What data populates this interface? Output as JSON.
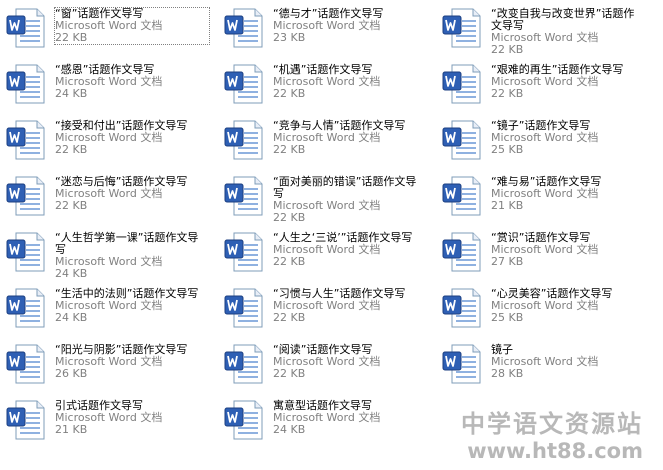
{
  "file_type_label": "Microsoft Word 文档",
  "icon": "word-document-icon",
  "colors": {
    "icon_page": "#ffffff",
    "icon_page_border": "#7f9db9",
    "icon_badge": "#2e5fb4",
    "icon_lines": "#8fb1e0",
    "type_text": "#808080",
    "watermark": "#b8b8b8"
  },
  "files": [
    {
      "name": "“窗”话题作文导写",
      "size": "22 KB",
      "selected": true
    },
    {
      "name": "“德与才”话题作文导写",
      "size": "23 KB"
    },
    {
      "name": "“改变自我与改变世界”话题作文导写",
      "size": "22 KB"
    },
    {
      "name": "“感恩”话题作文导写",
      "size": "24 KB"
    },
    {
      "name": "“机遇”话题作文导写",
      "size": "22 KB"
    },
    {
      "name": "“艰难的再生”话题作文导写",
      "size": "22 KB"
    },
    {
      "name": "“接受和付出”话题作文导写",
      "size": "22 KB"
    },
    {
      "name": "“竞争与人情”话题作文导写",
      "size": "22 KB"
    },
    {
      "name": "“镜子”话题作文导写",
      "size": "25 KB"
    },
    {
      "name": "“迷恋与后悔”话题作文导写",
      "size": "22 KB"
    },
    {
      "name": "“面对美丽的错误”话题作文导写",
      "size": "22 KB"
    },
    {
      "name": "“难与易”话题作文导写",
      "size": "21 KB"
    },
    {
      "name": "“人生哲学第一课”话题作文导写",
      "size": "24 KB"
    },
    {
      "name": "“人生之‘三说’”话题作文导写",
      "size": "22 KB"
    },
    {
      "name": "“赏识”话题作文导写",
      "size": "27 KB"
    },
    {
      "name": "“生活中的法则”话题作文导写",
      "size": "24 KB"
    },
    {
      "name": "“习惯与人生”话题作文导写",
      "size": "22 KB"
    },
    {
      "name": "“心灵美容”话题作文导写",
      "size": "25 KB"
    },
    {
      "name": "“阳光与阴影”话题作文导写",
      "size": "26 KB"
    },
    {
      "name": "“阅读”话题作文导写",
      "size": "22 KB"
    },
    {
      "name": "镜子",
      "size": "28 KB"
    },
    {
      "name": "引式话题作文导写",
      "size": "21 KB"
    },
    {
      "name": "寓意型话题作文导写",
      "size": "24 KB"
    }
  ],
  "watermark": {
    "title": "中学语文资源站",
    "url": "www.ht88.com"
  }
}
